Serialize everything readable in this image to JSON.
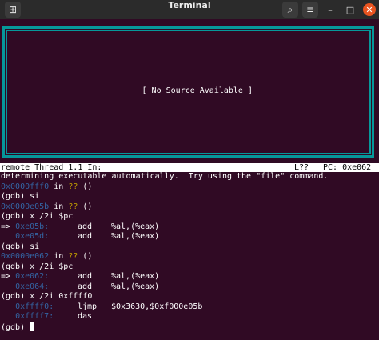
{
  "window": {
    "title": "Terminal"
  },
  "source_panel": {
    "message": "[ No Source Available ]"
  },
  "status_bar": {
    "thread": "remote Thread 1.1 In:",
    "line": "L??",
    "pc": "PC: 0xe062"
  },
  "terminal": {
    "l1": "determining executable automatically.  Try using the \"file\" command.",
    "l2_addr": "0x0000fff0",
    "l2_in": " in ",
    "l2_q": "??",
    "l2_tail": " ()",
    "l3": "(gdb) si",
    "l4_addr": "0x0000e05b",
    "l4_in": " in ",
    "l4_q": "??",
    "l4_tail": " ()",
    "l5": "(gdb) x /2i $pc",
    "l6_arrow": "=> ",
    "l6_addr": "0xe05b:",
    "l6_op": "add",
    "l6_args": "%al,(%eax)",
    "l7_addr": "0xe05d:",
    "l7_op": "add",
    "l7_args": "%al,(%eax)",
    "l8": "(gdb) si",
    "l9_addr": "0x0000e062",
    "l9_in": " in ",
    "l9_q": "??",
    "l9_tail": " ()",
    "l10": "(gdb) x /2i $pc",
    "l11_arrow": "=> ",
    "l11_addr": "0xe062:",
    "l11_op": "add",
    "l11_args": "%al,(%eax)",
    "l12_addr": "0xe064:",
    "l12_op": "add",
    "l12_args": "%al,(%eax)",
    "l13": "(gdb) x /2i 0xffff0",
    "l14_addr": "0xffff0:",
    "l14_op": "ljmp",
    "l14_args": "$0x3630,$0xf000e05b",
    "l15_addr": "0xffff7:",
    "l15_op": "das",
    "l16": "(gdb) "
  }
}
